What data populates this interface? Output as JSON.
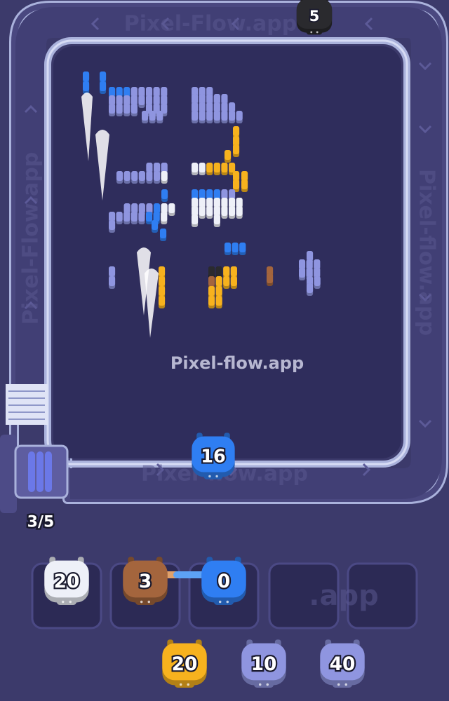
{
  "watermark": {
    "center": "Pixel-flow.app",
    "belt_top": "Pixel-Flow.app",
    "belt_right": "Pixel-flow.app",
    "belt_left": "Pixel-Flow.app",
    "belt_bottom": "Pixel-flow.app",
    "slot_area": ".app"
  },
  "belt_counter": "3/5",
  "colors": {
    "background": "#3c3a6b",
    "board": "#2f2d5c",
    "belt_rail": "#aab2dc",
    "white": "#eef0f8",
    "lavender": "#8f95e0",
    "blue": "#2f7ef2",
    "yellow": "#f7b21e",
    "brown": "#a4653d",
    "black": "#2a2a2e"
  },
  "shooters": {
    "top_black": {
      "value": "5",
      "color": "black"
    },
    "on_belt": {
      "value": "16",
      "color": "blue"
    }
  },
  "slots": [
    {
      "value": "20",
      "color": "white",
      "filled": true
    },
    {
      "value": "3",
      "color": "brown",
      "filled": true
    },
    {
      "value": "0",
      "color": "blue",
      "filled": true
    },
    {
      "value": "",
      "color": "",
      "filled": false
    },
    {
      "value": "",
      "color": "",
      "filled": false
    }
  ],
  "queue": [
    {
      "value": "20",
      "color": "yellow"
    },
    {
      "value": "10",
      "color": "lavender"
    },
    {
      "value": "40",
      "color": "lavender"
    }
  ]
}
